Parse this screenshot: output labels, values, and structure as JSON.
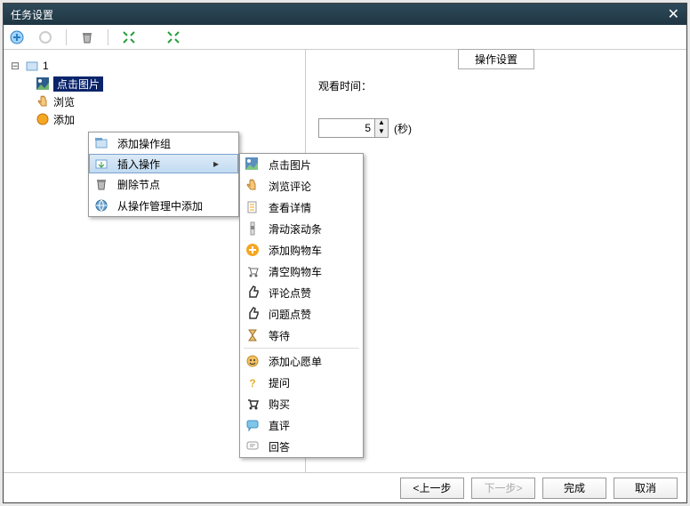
{
  "title": "任务设置",
  "tree": {
    "root": "1",
    "items": [
      "点击图片",
      "浏览",
      "添加"
    ]
  },
  "context_menu": {
    "items": [
      {
        "label": "添加操作组",
        "icon": "group"
      },
      {
        "label": "插入操作",
        "icon": "insert",
        "submenu": true,
        "highlighted": true
      },
      {
        "label": "删除节点",
        "icon": "trash"
      },
      {
        "label": "从操作管理中添加",
        "icon": "globe"
      }
    ]
  },
  "submenu": {
    "items": [
      {
        "label": "点击图片",
        "icon": "image"
      },
      {
        "label": "浏览评论",
        "icon": "hand"
      },
      {
        "label": "查看详情",
        "icon": "doc"
      },
      {
        "label": "滑动滚动条",
        "icon": "scroll"
      },
      {
        "label": "添加购物车",
        "icon": "cart-add"
      },
      {
        "label": "清空购物车",
        "icon": "cart-clear"
      },
      {
        "label": "评论点赞",
        "icon": "thumb"
      },
      {
        "label": "问题点赞",
        "icon": "thumb2"
      },
      {
        "label": "等待",
        "icon": "hourglass"
      },
      {
        "label": "添加心愿单",
        "icon": "wish"
      },
      {
        "label": "提问",
        "icon": "question"
      },
      {
        "label": "购买",
        "icon": "buy"
      },
      {
        "label": "直评",
        "icon": "comment"
      },
      {
        "label": "回答",
        "icon": "answer"
      }
    ],
    "separator_after": 8
  },
  "right_panel": {
    "tab": "操作设置",
    "watch_label": "观看时间：",
    "watch_value": "5",
    "watch_unit": "(秒)"
  },
  "footer": {
    "prev": "<上一步",
    "next": "下一步>",
    "finish": "完成",
    "cancel": "取消"
  },
  "colors": {
    "titlebar": "#1f3643",
    "accent": "#0a246a",
    "menu_hover": "#c2dbf2"
  }
}
